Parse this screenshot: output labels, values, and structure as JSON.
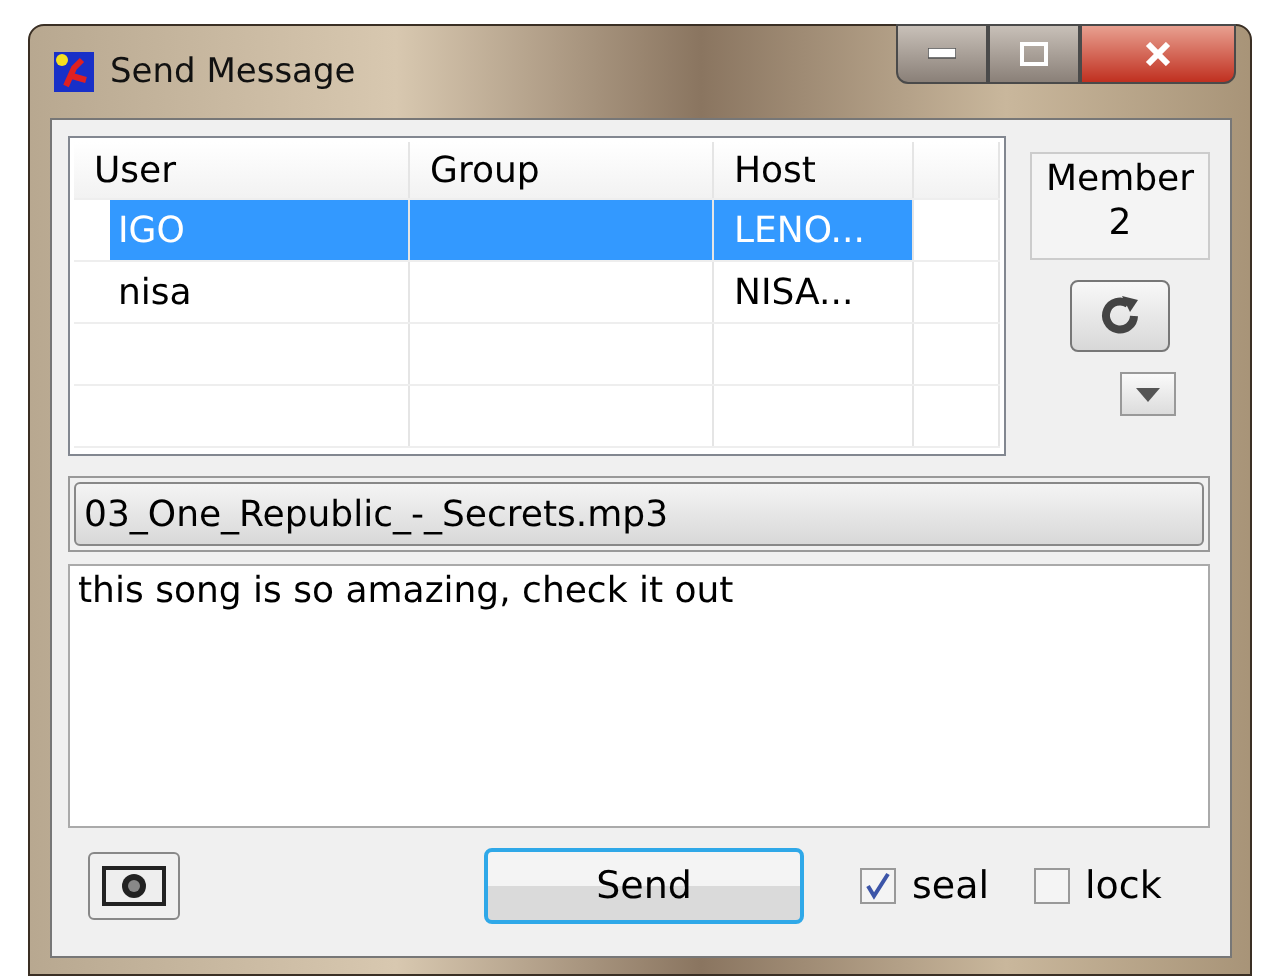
{
  "window": {
    "title": "Send Message"
  },
  "table": {
    "columns": [
      "User",
      "Group",
      "Host"
    ],
    "rows": [
      {
        "cells": [
          "IGO",
          "",
          "LENO..."
        ],
        "selected": true
      },
      {
        "cells": [
          "nisa",
          "",
          "NISA..."
        ],
        "selected": false
      }
    ]
  },
  "member": {
    "label": "Member",
    "count": "2"
  },
  "file": {
    "value": "03_One_Republic_-_Secrets.mp3"
  },
  "message": {
    "value": "this song is so amazing, check it out"
  },
  "send_button": "Send",
  "options": [
    {
      "label": "seal",
      "checked": true
    },
    {
      "label": "lock",
      "checked": false
    }
  ]
}
